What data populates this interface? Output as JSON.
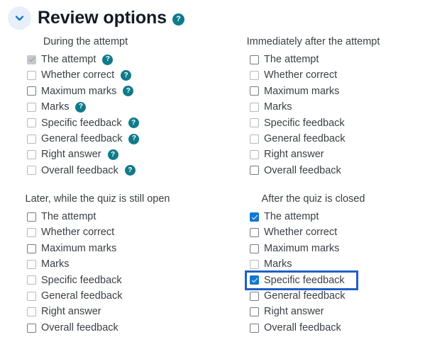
{
  "header": {
    "title": "Review options",
    "collapse_icon": "chevron-down-icon",
    "collapse_state": "expanded",
    "help_icon": "help-circle-icon",
    "help_glyph": "?",
    "accent_color": "#0f7b8a",
    "toggle_bg_color": "#e7effa",
    "chevron_color": "#1674d0"
  },
  "colors": {
    "checkbox_checked": "#1177d1",
    "checkbox_border_enabled": "#767b83",
    "checkbox_border_disabled": "#b5b8bd",
    "checkbox_disabled_fill": "#c6c8cc",
    "focus_outline": "#1f5fc4",
    "label_text": "#3b4046",
    "title_text": "#131b24",
    "page_background": "#ffffff"
  },
  "columns": [
    {
      "key": "during_attempt",
      "heading": "During the attempt",
      "show_help_icons": true,
      "options": [
        {
          "label": "The attempt",
          "checked": true,
          "disabled": true,
          "help": true,
          "focused": false
        },
        {
          "label": "Whether correct",
          "checked": false,
          "disabled": true,
          "help": true,
          "focused": false
        },
        {
          "label": "Maximum marks",
          "checked": false,
          "disabled": false,
          "help": true,
          "focused": false
        },
        {
          "label": "Marks",
          "checked": false,
          "disabled": true,
          "help": true,
          "focused": false
        },
        {
          "label": "Specific feedback",
          "checked": false,
          "disabled": true,
          "help": true,
          "focused": false
        },
        {
          "label": "General feedback",
          "checked": false,
          "disabled": true,
          "help": true,
          "focused": false
        },
        {
          "label": "Right answer",
          "checked": false,
          "disabled": true,
          "help": true,
          "focused": false
        },
        {
          "label": "Overall feedback",
          "checked": false,
          "disabled": true,
          "help": true,
          "focused": false
        }
      ]
    },
    {
      "key": "immediately_after",
      "heading": "Immediately after the attempt",
      "show_help_icons": false,
      "options": [
        {
          "label": "The attempt",
          "checked": false,
          "disabled": false,
          "help": false,
          "focused": false
        },
        {
          "label": "Whether correct",
          "checked": false,
          "disabled": true,
          "help": false,
          "focused": false
        },
        {
          "label": "Maximum marks",
          "checked": false,
          "disabled": false,
          "help": false,
          "focused": false
        },
        {
          "label": "Marks",
          "checked": false,
          "disabled": true,
          "help": false,
          "focused": false
        },
        {
          "label": "Specific feedback",
          "checked": false,
          "disabled": true,
          "help": false,
          "focused": false
        },
        {
          "label": "General feedback",
          "checked": false,
          "disabled": true,
          "help": false,
          "focused": false
        },
        {
          "label": "Right answer",
          "checked": false,
          "disabled": true,
          "help": false,
          "focused": false
        },
        {
          "label": "Overall feedback",
          "checked": false,
          "disabled": false,
          "help": false,
          "focused": false
        }
      ]
    },
    {
      "key": "later_while_open",
      "heading": "Later, while the quiz is still open",
      "show_help_icons": false,
      "options": [
        {
          "label": "The attempt",
          "checked": false,
          "disabled": false,
          "help": false,
          "focused": false
        },
        {
          "label": "Whether correct",
          "checked": false,
          "disabled": true,
          "help": false,
          "focused": false
        },
        {
          "label": "Maximum marks",
          "checked": false,
          "disabled": false,
          "help": false,
          "focused": false
        },
        {
          "label": "Marks",
          "checked": false,
          "disabled": true,
          "help": false,
          "focused": false
        },
        {
          "label": "Specific feedback",
          "checked": false,
          "disabled": true,
          "help": false,
          "focused": false
        },
        {
          "label": "General feedback",
          "checked": false,
          "disabled": true,
          "help": false,
          "focused": false
        },
        {
          "label": "Right answer",
          "checked": false,
          "disabled": true,
          "help": false,
          "focused": false
        },
        {
          "label": "Overall feedback",
          "checked": false,
          "disabled": false,
          "help": false,
          "focused": false
        }
      ]
    },
    {
      "key": "after_quiz_closed",
      "heading": "After the quiz is closed",
      "show_help_icons": false,
      "options": [
        {
          "label": "The attempt",
          "checked": true,
          "disabled": false,
          "help": false,
          "focused": false
        },
        {
          "label": "Whether correct",
          "checked": false,
          "disabled": false,
          "help": false,
          "focused": false
        },
        {
          "label": "Maximum marks",
          "checked": false,
          "disabled": false,
          "help": false,
          "focused": false
        },
        {
          "label": "Marks",
          "checked": false,
          "disabled": true,
          "help": false,
          "focused": false
        },
        {
          "label": "Specific feedback",
          "checked": true,
          "disabled": false,
          "help": false,
          "focused": true
        },
        {
          "label": "General feedback",
          "checked": false,
          "disabled": false,
          "help": false,
          "focused": false
        },
        {
          "label": "Right answer",
          "checked": false,
          "disabled": false,
          "help": false,
          "focused": false
        },
        {
          "label": "Overall feedback",
          "checked": false,
          "disabled": false,
          "help": false,
          "focused": false
        }
      ]
    }
  ]
}
